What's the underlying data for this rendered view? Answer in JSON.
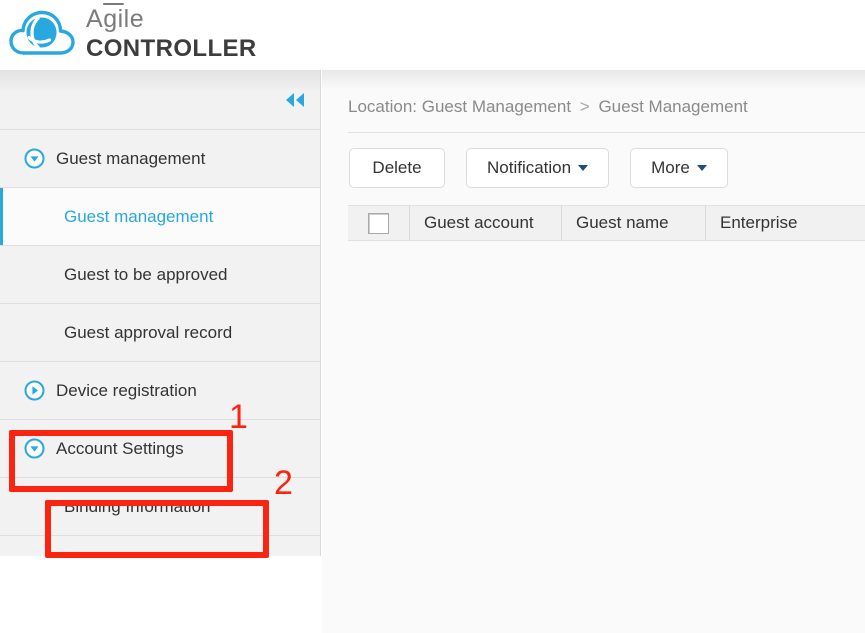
{
  "brand": {
    "name_light": "Agile",
    "name_light_pre": "A",
    "name_light_macron": "gi",
    "name_light_post": "le",
    "name_bold": "CONTROLLER",
    "logo_icon": "cloud-swirl-icon",
    "accent_color": "#29a8e0"
  },
  "sidebar": {
    "collapse_icon": "double-chevron-left-icon",
    "items": [
      {
        "label": "Guest management",
        "level": "parent",
        "icon": "circle-chevron-down-icon",
        "state": "expanded",
        "active": false
      },
      {
        "label": "Guest management",
        "level": "child",
        "icon": "",
        "state": "",
        "active": true
      },
      {
        "label": "Guest to be approved",
        "level": "child",
        "icon": "",
        "state": "",
        "active": false
      },
      {
        "label": "Guest approval record",
        "level": "child",
        "icon": "",
        "state": "",
        "active": false
      },
      {
        "label": "Device registration",
        "level": "parent",
        "icon": "circle-chevron-right-icon",
        "state": "collapsed",
        "active": false
      },
      {
        "label": "Account Settings",
        "level": "parent",
        "icon": "circle-chevron-down-icon",
        "state": "expanded",
        "active": false
      },
      {
        "label": "Binding Information",
        "level": "child",
        "icon": "",
        "state": "",
        "active": false
      }
    ]
  },
  "main": {
    "breadcrumb": {
      "prefix": "Location:",
      "first": "Guest Management",
      "separator": ">",
      "second": "Guest Management"
    },
    "toolbar": [
      {
        "label": "Delete",
        "has_caret": false
      },
      {
        "label": "Notification",
        "has_caret": true
      },
      {
        "label": "More",
        "has_caret": true
      }
    ],
    "table": {
      "select_all_checkbox": "unchecked",
      "columns": [
        "Guest account",
        "Guest name",
        "Enterprise"
      ]
    }
  },
  "annotations": {
    "color": "#fb2410",
    "marks": [
      {
        "number": "1",
        "target": "Account Settings"
      },
      {
        "number": "2",
        "target": "Binding Information"
      }
    ]
  }
}
